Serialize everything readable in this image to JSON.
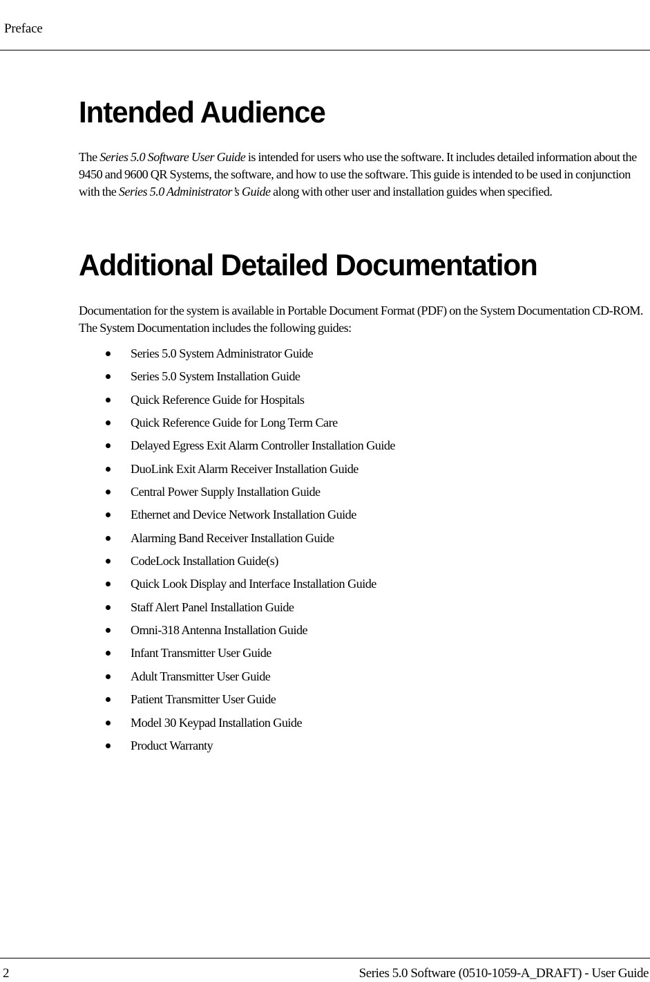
{
  "header": {
    "section_label": "Preface"
  },
  "sections": [
    {
      "title": "Intended Audience",
      "paragraph": {
        "t1": "The ",
        "i1": "Series 5.0 Software User Guide",
        "t2": " is intended for users who use the software. It includes detailed information about the 9450 and 9600 QR Systems, the software, and how to use the software. This guide is intended to be used in conjunction with the ",
        "i2": "Series 5.0 Administrator’s Guide",
        "t3": " along with other user and installation guides when specified."
      }
    },
    {
      "title": "Additional Detailed Documentation",
      "paragraph": "Documentation for the system is available in Portable Document Format (PDF) on the System Documentation CD-ROM. The System Documentation includes the following guides:",
      "guides": [
        "Series 5.0 System Administrator Guide",
        "Series 5.0 System Installation Guide",
        "Quick Reference Guide for Hospitals",
        "Quick Reference Guide for Long Term Care",
        "Delayed Egress Exit Alarm Controller Installation Guide",
        "DuoLink Exit Alarm Receiver Installation Guide",
        "Central Power Supply Installation Guide",
        "Ethernet and Device Network Installation Guide",
        "Alarming Band Receiver Installation Guide",
        "CodeLock Installation Guide(s)",
        "Quick Look Display and Interface Installation Guide",
        "Staff Alert Panel Installation Guide",
        "Omni-318 Antenna Installation Guide",
        "Infant Transmitter User Guide",
        "Adult Transmitter User Guide",
        "Patient Transmitter User Guide",
        "Model 30 Keypad Installation Guide",
        "Product Warranty"
      ]
    }
  ],
  "footer": {
    "page_number": "2",
    "document_title": "Series 5.0 Software (0510-1059-A_DRAFT) - User Guide"
  }
}
